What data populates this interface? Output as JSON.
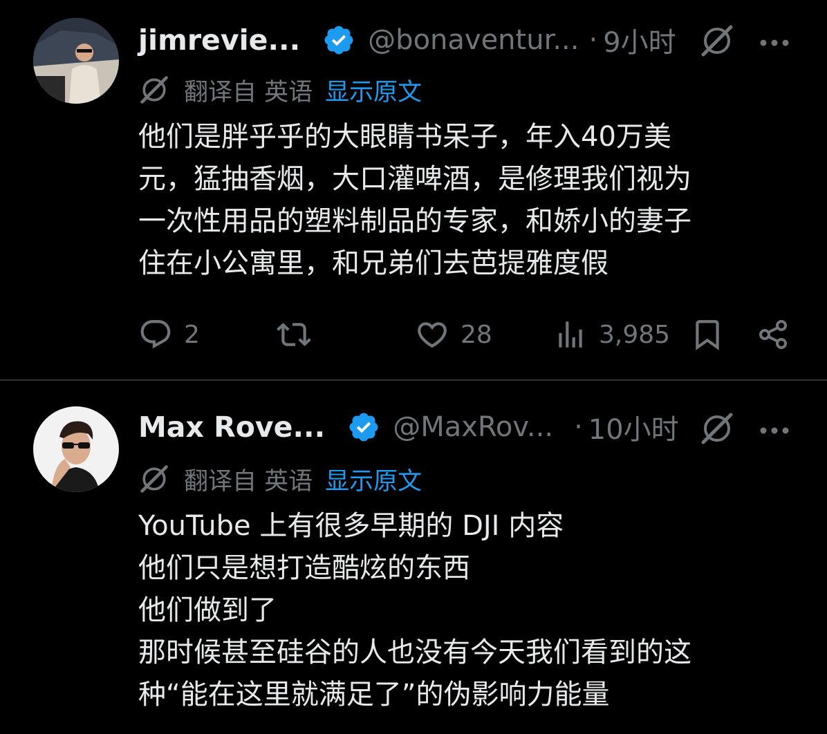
{
  "posts": [
    {
      "author_name": "jimrevie...",
      "handle": "@bonaventur...",
      "dot": "·",
      "time": "9小时",
      "translate_label": "翻译自 英语",
      "translate_link": "显示原文",
      "body_lines": [
        "他们是胖乎乎的大眼睛书呆子，年入40万美",
        "元，猛抽香烟，大口灌啤酒，是修理我们视为",
        "一次性用品的塑料制品的专家，和娇小的妻子",
        "住在小公寓里，和兄弟们去芭提雅度假"
      ],
      "replies": "2",
      "reposts": "",
      "likes": "28",
      "views": "3,985"
    },
    {
      "author_name": "Max Rove...",
      "handle": "@MaxRov...",
      "dot": "·",
      "time": "10小时",
      "translate_label": "翻译自 英语",
      "translate_link": "显示原文",
      "body_lines": [
        "YouTube 上有很多早期的 DJI 内容",
        "他们只是想打造酷炫的东西",
        "他们做到了",
        "那时候甚至硅谷的人也没有今天我们看到的这",
        "种“能在这里就满足了”的伪影响力能量"
      ]
    }
  ],
  "icons": {
    "verified": "verified-badge-icon",
    "grok": "grok-icon",
    "more": "more-icon",
    "reply": "reply-icon",
    "repost": "repost-icon",
    "like": "like-icon",
    "views": "views-icon",
    "bookmark": "bookmark-icon",
    "share": "share-icon"
  },
  "colors": {
    "background": "#000000",
    "text": "#e7e9ea",
    "secondary": "#71767b",
    "link": "#1d9bf0",
    "verified": "#1d9bf0"
  }
}
